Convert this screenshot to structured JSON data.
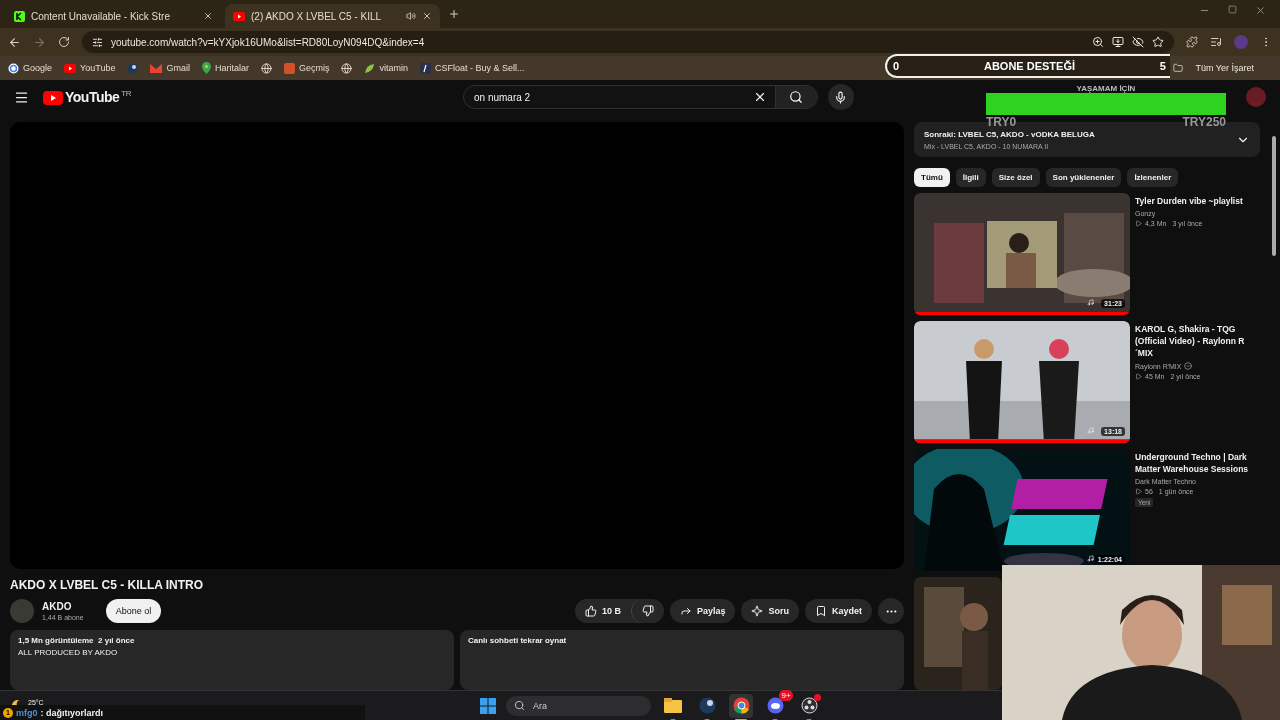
{
  "browser": {
    "tabs": [
      {
        "kind": "kick",
        "title": "Content Unavailable - Kick Stre",
        "audio": false,
        "selected": false
      },
      {
        "kind": "youtube",
        "title": "(2) AKDO X LVBEL C5 - KILL",
        "audio": true,
        "selected": true
      }
    ],
    "address": "youtube.com/watch?v=kYXjok16UMo&list=RD80LoyN094DQ&index=4",
    "bookmarks": [
      {
        "kind": "google",
        "label": "Google"
      },
      {
        "kind": "youtube",
        "label": "YouTube"
      },
      {
        "kind": "steam"
      },
      {
        "kind": "gmail",
        "label": "Gmail"
      },
      {
        "kind": "maps",
        "label": "Haritalar"
      },
      {
        "kind": "globe"
      },
      {
        "kind": "history",
        "label": "Geçmiş"
      },
      {
        "kind": "globe"
      },
      {
        "kind": "leaf",
        "label": "vitamin"
      },
      {
        "kind": "csfloat",
        "label": "CSFloat - Buy & Sell..."
      }
    ],
    "bookmarks_folder": "Tüm Yer İşaret"
  },
  "youtube": {
    "logo": "YouTube",
    "country": "TR",
    "search": "on numara 2",
    "video": {
      "title": "AKDO X LVBEL C5 - KILLA INTRO",
      "channel": "AKDO",
      "subscribers": "1,44 B abone",
      "subscribe": "Abone ol",
      "likes": "10 B",
      "actions": [
        {
          "kind": "share",
          "label": "Paylaş"
        },
        {
          "kind": "ask",
          "label": "Soru"
        },
        {
          "kind": "save",
          "label": "Kaydet"
        }
      ],
      "stats": "1,5 Mn görüntüleme  2 yıl önce",
      "description": "ALL PRODUCED BY AKDO",
      "chat_replay": "Canlı sohbeti tekrar oynat"
    },
    "up_next": {
      "title": "Sonraki: LVBEL C5, AKDO - vODKA BELUGA",
      "subtitle": "Mix - LVBEL C5, AKDO - 10 NUMARA II"
    },
    "chips": [
      {
        "label": "Tümü",
        "selected": true
      },
      {
        "label": "İlgili",
        "selected": false
      },
      {
        "label": "Size özel",
        "selected": false
      },
      {
        "label": "Son yüklenenler",
        "selected": false
      },
      {
        "label": "İzlenenler",
        "selected": false
      }
    ],
    "videos": [
      {
        "kind": "film",
        "title": "Tyler Durden vibe ~playlist",
        "channel": "Gonzy",
        "verified": false,
        "views": "4,3 Mn",
        "age": "3 yıl önce",
        "duration": "31:23",
        "level": 1
      },
      {
        "kind": "duo",
        "title": "KAROL G, Shakira - TQG (Official Video) - Raylonn R´MIX",
        "channel": "Raylonn R'MIX",
        "verified": true,
        "views": "45 Mn",
        "age": "2 yıl önce",
        "duration": "13:18",
        "level": 1
      },
      {
        "kind": "techno",
        "title": "Underground Techno | Dark Matter Warehouse Sessions",
        "channel": "Dark Matter Techno",
        "verified": false,
        "views": "56",
        "age": "1 gün önce",
        "duration": "1:22:04",
        "badge": "Yeni"
      },
      {
        "kind": "studio"
      }
    ]
  },
  "stream_overlay": {
    "goal": {
      "title": "ABONE DESTEĞİ",
      "current": "0",
      "target": "5"
    },
    "donation": {
      "title": "YAŞAMAM İÇİN",
      "level": 1,
      "min": "TRY0",
      "max": "TRY250"
    },
    "chat": {
      "badge": "1",
      "user": "mfg0",
      "message": ": dağıtıyorlardı"
    }
  },
  "taskbar": {
    "weather": "25°C",
    "search_placeholder": "Ara",
    "apps": [
      {
        "kind": "files",
        "active": false,
        "alert": false
      },
      {
        "kind": "steam",
        "active": false,
        "alert": false
      },
      {
        "kind": "chrome",
        "active": true,
        "alert": false
      },
      {
        "kind": "discord",
        "badge": "9+",
        "active": false,
        "alert": false
      },
      {
        "kind": "obs",
        "active": false,
        "alert": true
      }
    ]
  }
}
